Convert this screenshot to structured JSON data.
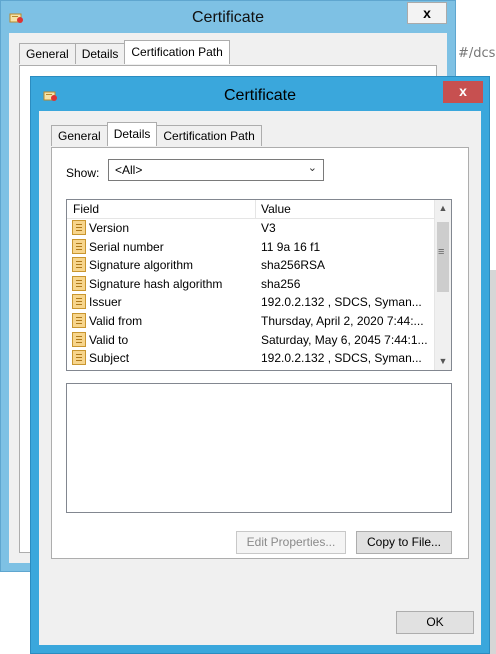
{
  "background": {
    "url_fragment": "#/dcs"
  },
  "back_window": {
    "title": "Certificate",
    "close_label": "x",
    "tabs": [
      {
        "label": "General"
      },
      {
        "label": "Details"
      },
      {
        "label": "Certification Path"
      }
    ],
    "active_tab": "Certification Path"
  },
  "front_window": {
    "title": "Certificate",
    "close_label": "x",
    "tabs": [
      {
        "label": "General"
      },
      {
        "label": "Details"
      },
      {
        "label": "Certification Path"
      }
    ],
    "active_tab": "Details",
    "show": {
      "label": "Show:",
      "value": "<All>"
    },
    "grid": {
      "columns": [
        "Field",
        "Value"
      ],
      "rows": [
        {
          "field": "Version",
          "value": "V3"
        },
        {
          "field": "Serial number",
          "value": "11 9a 16 f1"
        },
        {
          "field": "Signature algorithm",
          "value": "sha256RSA"
        },
        {
          "field": "Signature hash algorithm",
          "value": "sha256"
        },
        {
          "field": "Issuer",
          "value": " 192.0.2.132 , SDCS, Syman..."
        },
        {
          "field": "Valid from",
          "value": "Thursday, April 2, 2020 7:44:..."
        },
        {
          "field": "Valid to",
          "value": "Saturday, May 6, 2045 7:44:1..."
        },
        {
          "field": "Subject",
          "value": " 192.0.2.132 , SDCS, Syman..."
        }
      ]
    },
    "buttons": {
      "edit_properties": "Edit Properties...",
      "copy_to_file": "Copy to File...",
      "ok": "OK"
    }
  },
  "colors": {
    "back_titlebar": "#7ec1e4",
    "front_titlebar": "#3aa7dc",
    "close_red": "#c75050"
  }
}
